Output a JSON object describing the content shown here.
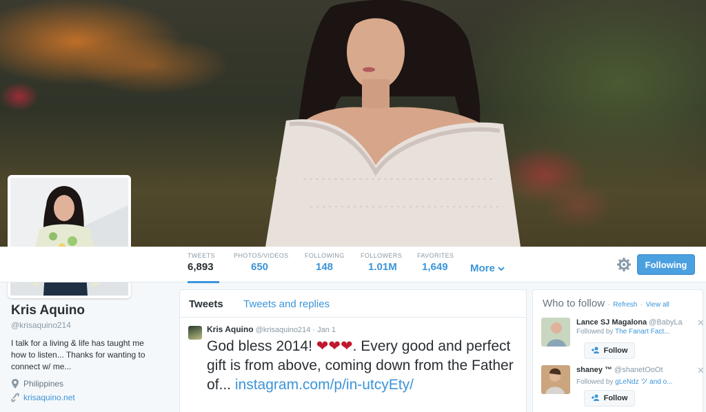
{
  "colors": {
    "accent": "#3b94d9",
    "follow_blue": "#4ba0e0",
    "heart": "#c0192e"
  },
  "header": {
    "banner_alt": ""
  },
  "profile_nav": {
    "stats": [
      {
        "label": "TWEETS",
        "value": "6,893"
      },
      {
        "label": "PHOTOS/VIDEOS",
        "value": "650"
      },
      {
        "label": "FOLLOWING",
        "value": "148"
      },
      {
        "label": "FOLLOWERS",
        "value": "1.01M"
      },
      {
        "label": "FAVORITES",
        "value": "1,649"
      }
    ],
    "more_label": "More",
    "more_icon": "chevron-down-icon",
    "settings_icon": "gear-icon",
    "following_label": "Following"
  },
  "profile": {
    "name": "Kris Aquino",
    "handle": "@krisaquino214",
    "bio": "I talk for a living & life has taught me how to listen... Thanks for wanting to connect w/ me...",
    "location": "Philippines",
    "location_icon": "location-pin-icon",
    "url": "krisaquino.net",
    "url_icon": "link-icon"
  },
  "timeline": {
    "tabs": [
      "Tweets",
      "Tweets and replies"
    ],
    "tweet": {
      "name": "Kris Aquino",
      "handle": "@krisaquino214",
      "sep": "·",
      "date": "Jan 1",
      "text_before": "God bless 2014! ",
      "hearts": "❤❤❤",
      "text_after": ".   Every good and perfect gift is from above, coming down from the Father of... ",
      "link": "instagram.com/p/in-utcyEty/"
    }
  },
  "who_to_follow": {
    "title": "Who to follow",
    "dot": "·",
    "refresh": "Refresh",
    "view_all": "View all",
    "suggestions": [
      {
        "name": "Lance SJ Magalona",
        "handle": "@BabyLa...",
        "followed_by_prefix": "Followed by",
        "followed_by": "The Fanart Fact...",
        "follow_label": "Follow"
      },
      {
        "name": "shaney ™",
        "handle": "@shanetOoOt",
        "followed_by_prefix": "Followed by",
        "followed_by": "gLeNdz ツ and o...",
        "follow_label": "Follow"
      }
    ],
    "dismiss_icon": "close-icon",
    "follow_icon": "add-user-icon"
  }
}
